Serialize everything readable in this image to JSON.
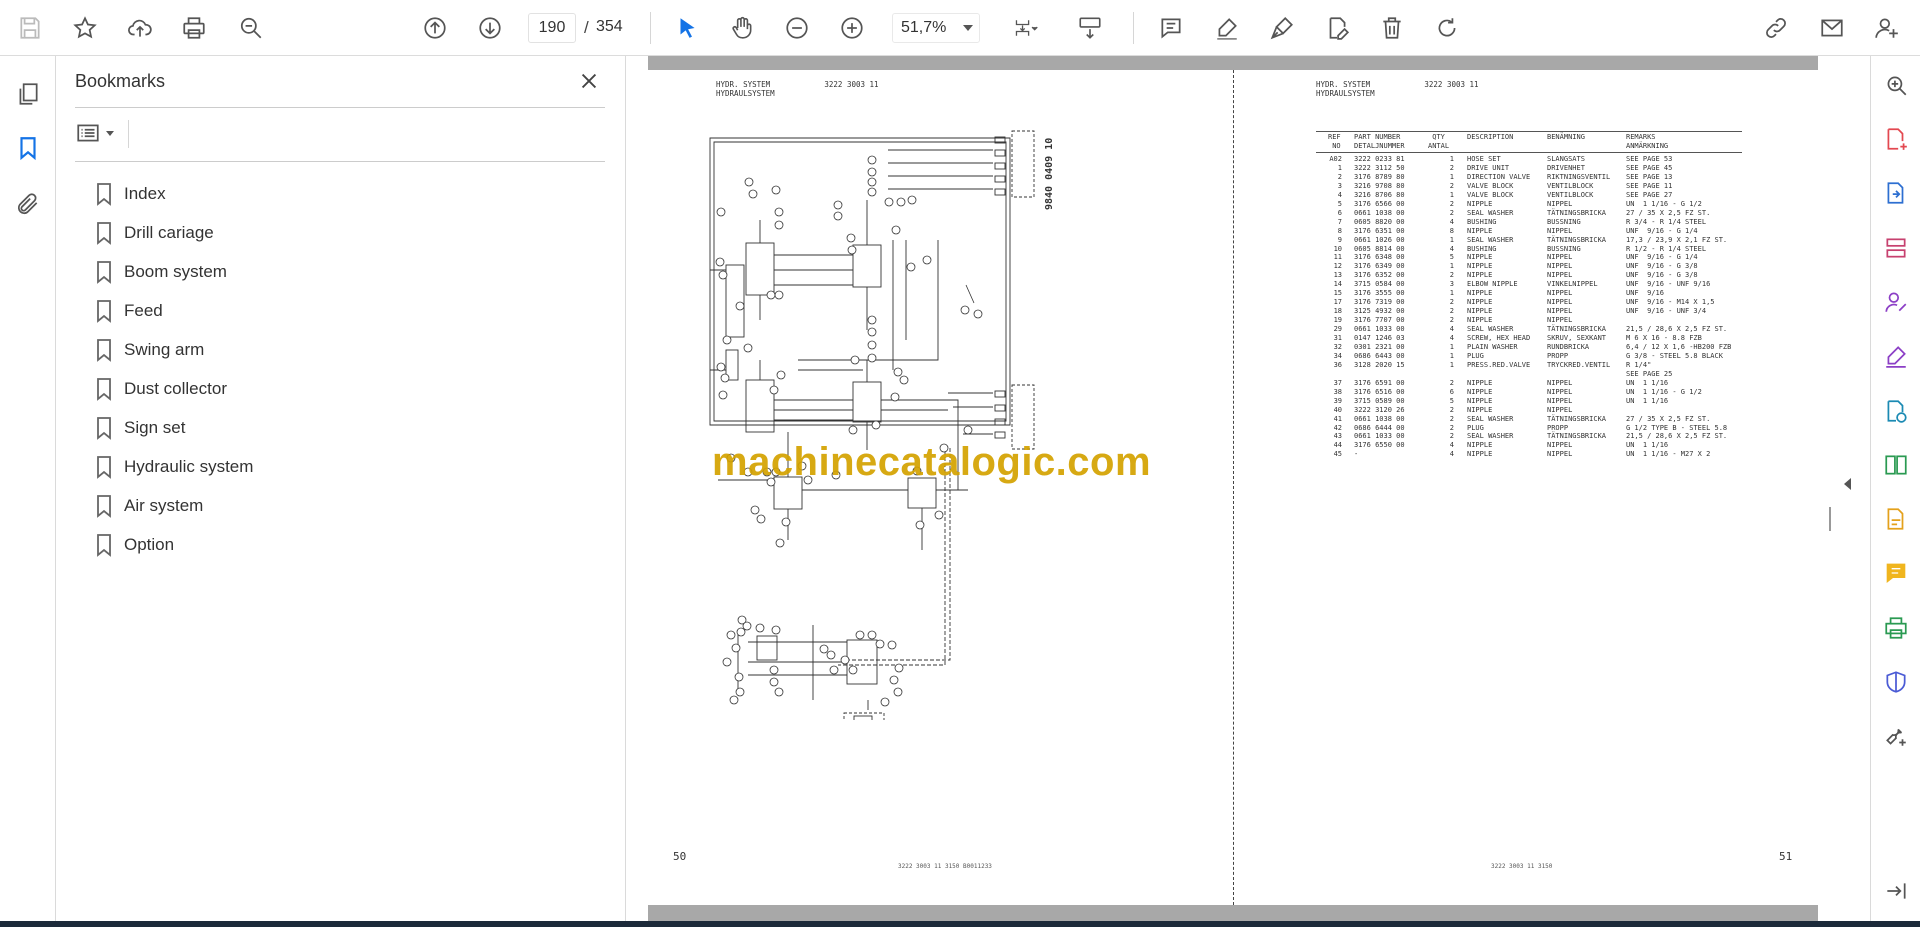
{
  "toolbar": {
    "page_current": "190",
    "page_separator": "/",
    "page_total": "354",
    "zoom": "51,7%"
  },
  "bookmarks_panel": {
    "title": "Bookmarks",
    "items": [
      {
        "label": "Index"
      },
      {
        "label": "Drill cariage"
      },
      {
        "label": "Boom system"
      },
      {
        "label": "Feed"
      },
      {
        "label": "Swing arm"
      },
      {
        "label": "Dust collector"
      },
      {
        "label": "Sign set"
      },
      {
        "label": "Hydraulic system"
      },
      {
        "label": "Air system"
      },
      {
        "label": "Option"
      }
    ]
  },
  "document": {
    "left_page": {
      "header_line1": "HYDR. SYSTEM            3222 3003 11",
      "header_line2": "HYDRAULSYSTEM",
      "diagram_code": "9840 0409 10",
      "page_number": "50",
      "footer": "3222 3003 11   3150   B0011233"
    },
    "right_page": {
      "header_line1": "HYDR. SYSTEM            3222 3003 11",
      "header_line2": "HYDRAULSYSTEM",
      "page_number": "51",
      "footer": "3222 3003 11   3150",
      "columns": {
        "ref": "REF\n NO",
        "part": "PART NUMBER\nDETALJNUMMER",
        "qty": " QTY\nANTAL",
        "desc": "DESCRIPTION",
        "swe": "BENÄMNING",
        "rem": "REMARKS\nANMÄRKNING"
      },
      "rows": [
        [
          "A02",
          "3222 0233 81",
          "1",
          "HOSE SET",
          "SLANGSATS",
          "SEE PAGE 53"
        ],
        [
          "1",
          "3222 3112 50",
          "2",
          "DRIVE UNIT",
          "DRIVENHET",
          "SEE PAGE 45"
        ],
        [
          "2",
          "3176 8789 80",
          "1",
          "DIRECTION VALVE",
          "RIKTNINGSVENTIL",
          "SEE PAGE 13"
        ],
        [
          "3",
          "3216 9708 80",
          "2",
          "VALVE BLOCK",
          "VENTILBLOCK",
          "SEE PAGE 11"
        ],
        [
          "4",
          "3216 8706 80",
          "1",
          "VALVE BLOCK",
          "VENTILBLOCK",
          "SEE PAGE 27"
        ],
        [
          "5",
          "3176 6566 00",
          "2",
          "NIPPLE",
          "NIPPEL",
          "UN  1 1/16 - G 1/2"
        ],
        [
          "6",
          "0661 1038 00",
          "2",
          "SEAL WASHER",
          "TÄTNINGSBRICKA",
          "27 / 35 X 2,5 FZ ST."
        ],
        [
          "7",
          "0605 8820 00",
          "4",
          "BUSHING",
          "BUSSNING",
          "R 3/4 - R 1/4 STEEL"
        ],
        [
          "8",
          "3176 6351 00",
          "8",
          "NIPPLE",
          "NIPPEL",
          "UNF  9/16 - G 1/4"
        ],
        [
          "9",
          "0661 1026 00",
          "1",
          "SEAL WASHER",
          "TÄTNINGSBRICKA",
          "17,3 / 23,9 X 2,1 FZ ST."
        ],
        [
          "10",
          "0605 8814 00",
          "4",
          "BUSHING",
          "BUSSNING",
          "R 1/2 - R 1/4 STEEL"
        ],
        [
          "11",
          "3176 6348 00",
          "5",
          "NIPPLE",
          "NIPPEL",
          "UNF  9/16 - G 1/4"
        ],
        [
          "12",
          "3176 6349 00",
          "1",
          "NIPPLE",
          "NIPPEL",
          "UNF  9/16 - G 3/8"
        ],
        [
          "13",
          "3176 6352 00",
          "2",
          "NIPPLE",
          "NIPPEL",
          "UNF  9/16 - G 3/8"
        ],
        [
          "14",
          "3715 0584 00",
          "3",
          "ELBOW NIPPLE",
          "VINKELNIPPEL",
          "UNF  9/16 - UNF 9/16"
        ],
        [
          "15",
          "3176 3555 00",
          "1",
          "NIPPLE",
          "NIPPEL",
          "UNF  9/16"
        ],
        [
          "17",
          "3176 7319 00",
          "2",
          "NIPPLE",
          "NIPPEL",
          "UNF  9/16 - M14 X 1,5"
        ],
        [
          "18",
          "3125 4932 00",
          "2",
          "NIPPLE",
          "NIPPEL",
          "UNF  9/16 - UNF 3/4"
        ],
        [
          "19",
          "3176 7707 00",
          "2",
          "NIPPLE",
          "NIPPEL",
          ""
        ],
        [
          "29",
          "0661 1033 00",
          "4",
          "SEAL WASHER",
          "TÄTNINGSBRICKA",
          "21,5 / 28,6 X 2,5 FZ ST."
        ],
        [
          "31",
          "0147 1246 03",
          "4",
          "SCREW, HEX HEAD",
          "SKRUV, SEXKANT",
          "M 6 X 16 - 8.8 FZB"
        ],
        [
          "32",
          "0301 2321 00",
          "1",
          "PLAIN WASHER",
          "RUNDBRICKA",
          "6,4 / 12 X 1,6 -HB200 FZB"
        ],
        [
          "34",
          "0686 6443 00",
          "1",
          "PLUG",
          "PROPP",
          "G 3/8 - STEEL 5.8 BLACK"
        ],
        [
          "36",
          "3128 2020 15",
          "1",
          "PRESS.RED.VALVE",
          "TRYCKRED.VENTIL",
          "R 1/4\""
        ],
        [
          "",
          "",
          "",
          "",
          "",
          "SEE PAGE 25"
        ],
        [
          "37",
          "3176 6591 00",
          "2",
          "NIPPLE",
          "NIPPEL",
          "UN  1 1/16"
        ],
        [
          "38",
          "3176 6516 00",
          "6",
          "NIPPLE",
          "NIPPEL",
          "UN  1 1/16 - G 1/2"
        ],
        [
          "39",
          "3715 0589 00",
          "5",
          "NIPPLE",
          "NIPPEL",
          "UN  1 1/16"
        ],
        [
          "40",
          "3222 3120 26",
          "2",
          "NIPPLE",
          "NIPPEL",
          ""
        ],
        [
          "41",
          "0661 1038 00",
          "2",
          "SEAL WASHER",
          "TÄTNINGSBRICKA",
          "27 / 35 X 2,5 FZ ST."
        ],
        [
          "42",
          "0686 6444 00",
          "2",
          "PLUG",
          "PROPP",
          "G 1/2 TYPE B - STEEL 5.8"
        ],
        [
          "43",
          "0661 1033 00",
          "2",
          "SEAL WASHER",
          "TÄTNINGSBRICKA",
          "21,5 / 28,6 X 2,5 FZ ST."
        ],
        [
          "44",
          "3176 6550 00",
          "4",
          "NIPPLE",
          "NIPPEL",
          "UN  1 1/16"
        ],
        [
          "45",
          "-",
          "4",
          "NIPPLE",
          "NIPPEL",
          "UN  1 1/16 - M27 X 2"
        ]
      ]
    },
    "watermark": "machinecatalogic.com"
  },
  "colors": {
    "accent_blue": "#1473e6",
    "watermark": "#d4a200"
  }
}
